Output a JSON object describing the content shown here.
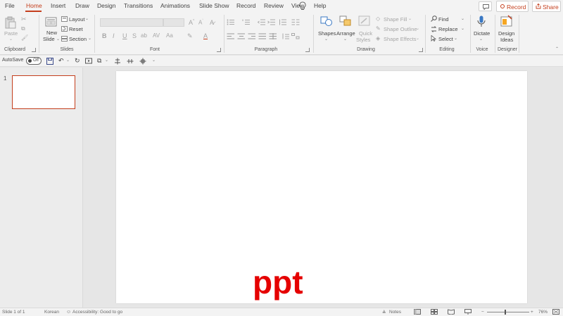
{
  "tabs": [
    {
      "label": "File"
    },
    {
      "label": "Home"
    },
    {
      "label": "Insert"
    },
    {
      "label": "Draw"
    },
    {
      "label": "Design"
    },
    {
      "label": "Transitions"
    },
    {
      "label": "Animations"
    },
    {
      "label": "Slide Show"
    },
    {
      "label": "Record"
    },
    {
      "label": "Review"
    },
    {
      "label": "View"
    },
    {
      "label": "Help"
    }
  ],
  "active_tab": "Home",
  "title_actions": {
    "record_label": "Record",
    "share_label": "Share"
  },
  "ribbon": {
    "clipboard": {
      "paste": "Paste",
      "group": "Clipboard"
    },
    "slides": {
      "new_slide_1": "New",
      "new_slide_2": "Slide",
      "layout": "Layout",
      "reset": "Reset",
      "section": "Section",
      "group": "Slides"
    },
    "font": {
      "group": "Font"
    },
    "paragraph": {
      "group": "Paragraph"
    },
    "drawing": {
      "shapes": "Shapes",
      "arrange": "Arrange",
      "quick_styles_1": "Quick",
      "quick_styles_2": "Styles",
      "shape_fill": "Shape Fill",
      "shape_outline": "Shape Outline",
      "shape_effects": "Shape Effects",
      "group": "Drawing"
    },
    "editing": {
      "find": "Find",
      "replace": "Replace",
      "select": "Select",
      "group": "Editing"
    },
    "voice": {
      "dictate": "Dictate",
      "group": "Voice"
    },
    "designer": {
      "design_ideas_1": "Design",
      "design_ideas_2": "Ideas",
      "group": "Designer"
    }
  },
  "qat": {
    "autosave_label": "AutoSave",
    "autosave_state": "Off"
  },
  "thumbnails": [
    {
      "number": "1"
    }
  ],
  "watermark_text": "ppt",
  "status": {
    "slide_info": "Slide 1 of 1",
    "language": "Korean",
    "accessibility": "Accessibility: Good to go",
    "notes": "Notes",
    "zoom": "76%"
  },
  "colors": {
    "accent": "#c43e1c",
    "watermark": "#e50000"
  }
}
